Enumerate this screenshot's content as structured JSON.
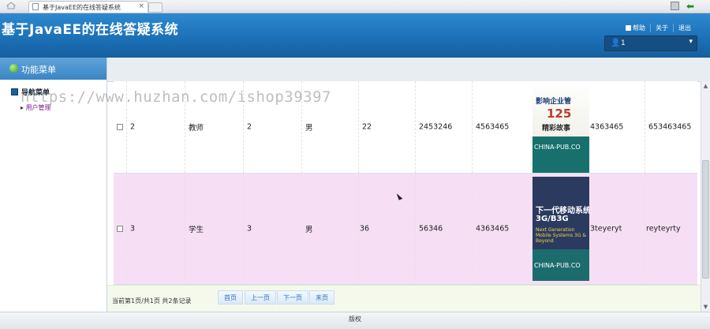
{
  "browser": {
    "tab_title": "基于JavaEE的在线答疑系统",
    "tab_close": "×"
  },
  "app": {
    "title": "基于JavaEE的在线答疑系统",
    "nav": {
      "help": "帮助",
      "about": "关于",
      "logout": "退出"
    },
    "user": {
      "name": "1",
      "caret": "▾"
    }
  },
  "sidebar": {
    "header": "功能菜单",
    "group": "导航菜单",
    "items": [
      {
        "arrow": "▸",
        "label": "用户管理"
      }
    ]
  },
  "table": {
    "rows": [
      {
        "id": "2",
        "role": "教师",
        "col3": "2",
        "gender": "男",
        "age": "22",
        "col6": "2453246",
        "col7": "4563465",
        "cover": {
          "title1": "影响企业管",
          "num": "125",
          "title2": "精彩故事",
          "brand": "CHINA-PUB.CO"
        },
        "col9": "4363465",
        "col10": "653463465"
      },
      {
        "id": "3",
        "role": "学生",
        "col3": "3",
        "gender": "男",
        "age": "36",
        "col6": "56346",
        "col7": "4363465",
        "cover": {
          "title1": "下一代移动系统",
          "title2": "3G/B3G",
          "sub": "Next Generation Mobile Systems 3G & Beyond",
          "brand": "CHINA-PUB.CO"
        },
        "col9": "3teyeryt",
        "col10": "reyteyrty"
      }
    ]
  },
  "pager": {
    "info": "当前第1页/共1页  共2条记录",
    "first": "首页",
    "prev": "上一页",
    "next": "下一页",
    "last": "末页"
  },
  "footer": {
    "text": "版权"
  },
  "watermark": "https://www.huzhan.com/ishop39397",
  "colors": {
    "header": "#1b6fb5",
    "row_alt": "#f6dff5",
    "pager_bg": "#f5f9ec"
  }
}
